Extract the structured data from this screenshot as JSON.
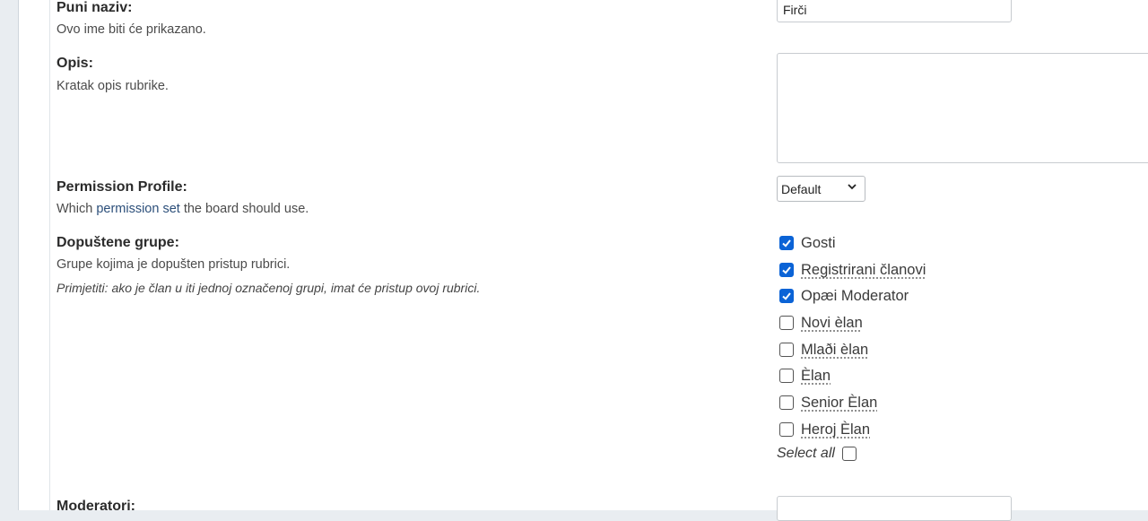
{
  "fields": {
    "full_name": {
      "title": "Puni naziv:",
      "description": "Ovo ime biti će prikazano.",
      "value": "Firči"
    },
    "description": {
      "title": "Opis:",
      "description": "Kratak opis rubrike.",
      "value": ""
    },
    "permission_profile": {
      "title": "Permission Profile:",
      "description_before": "Which ",
      "link": "permission set",
      "description_after": " the board should use.",
      "selected": "Default"
    },
    "allowed_groups": {
      "title": "Dopuštene grupe:",
      "description": "Grupe kojima je dopušten pristup rubrici.",
      "note": "Primjetiti: ako je član u iti jednoj označenoj grupi, imat će pristup ovoj rubrici.",
      "groups": [
        {
          "label": "Gosti",
          "checked": true
        },
        {
          "label": "Registrirani članovi",
          "checked": true
        },
        {
          "label": "Opæi Moderator",
          "checked": true
        },
        {
          "label": "Novi èlan",
          "checked": false
        },
        {
          "label": "Mlaði èlan",
          "checked": false
        },
        {
          "label": "Èlan",
          "checked": false
        },
        {
          "label": "Senior Èlan",
          "checked": false
        },
        {
          "label": "Heroj Èlan",
          "checked": false
        }
      ],
      "select_all_label": "Select all"
    },
    "moderators": {
      "title": "Moderatori:"
    }
  },
  "colors": {
    "checkbox_checked": "#0b63d6",
    "link": "#2c4f7a"
  }
}
